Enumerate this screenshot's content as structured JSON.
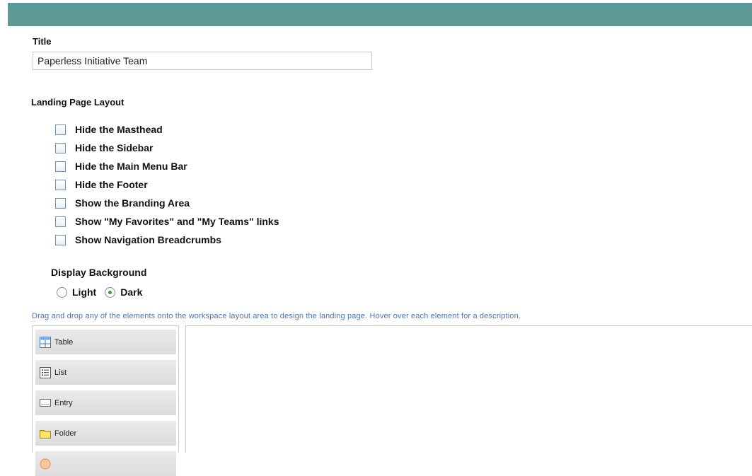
{
  "form": {
    "title_label": "Title",
    "title_value": "Paperless Initiative Team",
    "layout_label": "Landing Page Layout",
    "layout_options": [
      {
        "label": "Hide the Masthead",
        "checked": false
      },
      {
        "label": "Hide the Sidebar",
        "checked": false
      },
      {
        "label": "Hide the Main Menu Bar",
        "checked": false
      },
      {
        "label": "Hide the Footer",
        "checked": false
      },
      {
        "label": "Show the Branding Area",
        "checked": false
      },
      {
        "label": "Show \"My Favorites\" and \"My Teams\" links",
        "checked": false
      },
      {
        "label": "Show Navigation Breadcrumbs",
        "checked": false
      }
    ],
    "background_label": "Display Background",
    "background_light": "Light",
    "background_dark": "Dark",
    "background_selected": "Dark"
  },
  "designer": {
    "hint": "Drag and drop any of the elements onto the workspace layout area to design the landing page. Hover over each element for a description.",
    "palette": [
      {
        "label": "Table",
        "icon": "table-icon"
      },
      {
        "label": "List",
        "icon": "list-icon"
      },
      {
        "label": "Entry",
        "icon": "entry-icon"
      },
      {
        "label": "Folder",
        "icon": "folder-icon"
      },
      {
        "label": "",
        "icon": "circle-icon"
      }
    ]
  },
  "colors": {
    "header_bar": "#5e9b98",
    "hint_text": "#4a76b8"
  }
}
